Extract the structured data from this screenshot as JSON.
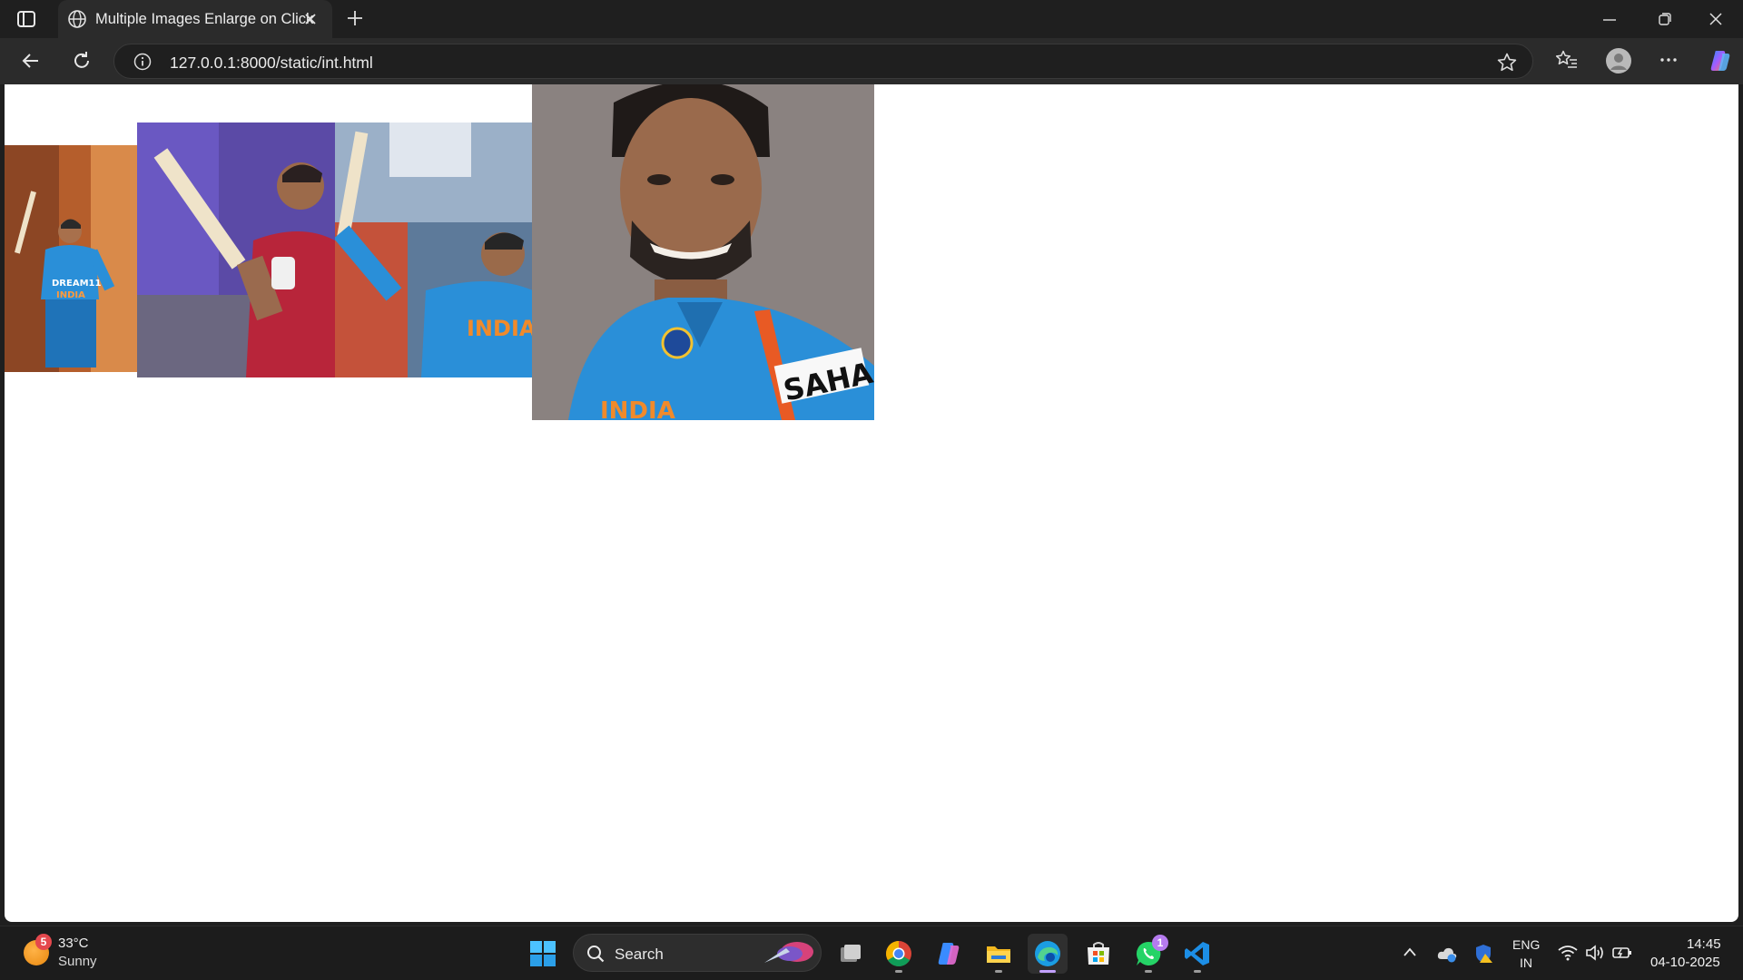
{
  "browser": {
    "tab": {
      "title": "Multiple Images Enlarge on Click",
      "favicon": "globe-icon"
    },
    "address_bar": {
      "url": "127.0.0.1:8000/static/int.html",
      "info_icon": "info-icon"
    },
    "icons": [
      "tab-actions-icon",
      "close-icon",
      "plus-icon",
      "minimize-icon",
      "restore-icon",
      "back-arrow-icon",
      "reload-icon",
      "star-icon",
      "favorites-icon",
      "profile-icon",
      "more-icon",
      "copilot-icon"
    ]
  },
  "page": {
    "images": [
      {
        "name": "cricketer-photo-1",
        "state": "small"
      },
      {
        "name": "cricketer-photo-2",
        "state": "medium"
      },
      {
        "name": "cricketer-photo-3",
        "state": "medium"
      },
      {
        "name": "cricketer-photo-4",
        "state": "enlarged"
      }
    ]
  },
  "taskbar": {
    "weather": {
      "badge": "5",
      "temp": "33°C",
      "condition": "Sunny"
    },
    "search": {
      "label": "Search"
    },
    "apps": [
      "start-icon",
      "task-view-icon",
      "chrome-icon",
      "copilot-app-icon",
      "file-explorer-icon",
      "edge-icon",
      "store-icon",
      "whatsapp-icon",
      "vscode-icon"
    ],
    "whatsapp_badge": "1",
    "tray": {
      "lang_line1": "ENG",
      "lang_line2": "IN",
      "time": "14:45",
      "date": "04-10-2025"
    }
  },
  "colors": {
    "chrome_bg": "#1f1f1f",
    "toolbar_bg": "#2b2b2b",
    "page_bg": "#ffffff",
    "jersey_blue": "#2a8fd8"
  }
}
